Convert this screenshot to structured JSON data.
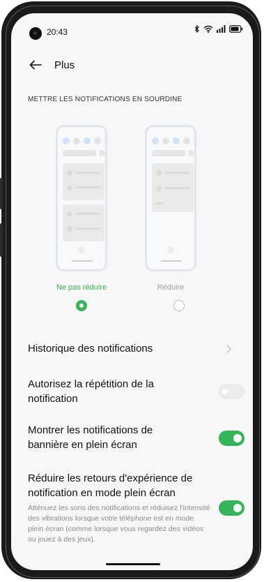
{
  "status_bar": {
    "time": "20:43",
    "icons": [
      "bluetooth-icon",
      "wifi-icon",
      "signal-icon",
      "battery-icon"
    ]
  },
  "header": {
    "title": "Plus"
  },
  "mute_section": {
    "title": "METTRE LES NOTIFICATIONS EN SOURDINE",
    "options": [
      {
        "label": "Ne pas réduire",
        "selected": true
      },
      {
        "label": "Réduire",
        "selected": false
      }
    ]
  },
  "settings": [
    {
      "title": "Historique des notifications",
      "control": "chevron"
    },
    {
      "title": "Autorisez la répétition de la notification",
      "control": "toggle",
      "on": false
    },
    {
      "title": "Montrer les notifications de bannière en plein écran",
      "control": "toggle",
      "on": true
    },
    {
      "title": "Réduire les retours d'expérience de notification en mode plein écran",
      "description": "Atténuez les sons des notifications et réduisez l'intensité des vibrations lorsque votre téléphone est en mode plein écran (comme lorsque vous regardez des vidéos ou jouez à des jeux).",
      "control": "toggle",
      "on": true
    }
  ],
  "colors": {
    "accent": "#36b45a",
    "background": "#f7f7f7",
    "illustration_blue": "#cfe3f8"
  }
}
